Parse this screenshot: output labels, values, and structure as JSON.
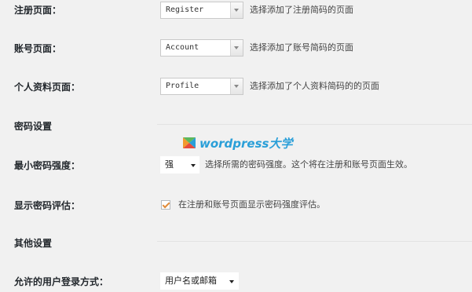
{
  "colors": {
    "background": "#f1f1f1",
    "watermark": "#2a9fd8",
    "checkbox_mark": "#e08b3a"
  },
  "fields": {
    "register_page": {
      "label": "注册页面：",
      "value": "Register",
      "description": "选择添加了注册简码的页面"
    },
    "account_page": {
      "label": "账号页面：",
      "value": "Account",
      "description": "选择添加了账号简码的页面"
    },
    "profile_page": {
      "label": "个人资料页面：",
      "value": "Profile",
      "description": "选择添加了个人资料简码的的页面"
    }
  },
  "sections": {
    "password_settings": "密码设置",
    "other_settings": "其他设置"
  },
  "password": {
    "min_strength": {
      "label": "最小密码强度：",
      "value": "强",
      "description": "选择所需的密码强度。这个将在注册和账号页面生效。"
    },
    "show_meter": {
      "label": "显示密码评估：",
      "checked": true,
      "description": "在注册和账号页面显示密码强度评估。"
    }
  },
  "login_method": {
    "label": "允许的用户登录方式：",
    "value": "用户名或邮箱"
  },
  "watermark": {
    "text": "wordpress大学",
    "icon": "wordpress-daxue-logo-icon"
  }
}
